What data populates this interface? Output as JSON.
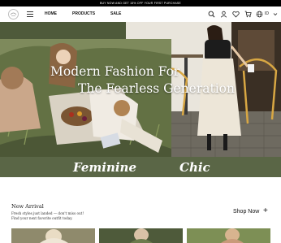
{
  "announcement": "BUY NOW AND GET 15% OFF YOUR FIRST PURCHASE",
  "nav": {
    "links": [
      "HOME",
      "PRODUCTS",
      "SALE"
    ],
    "icons": [
      "search-icon",
      "account-icon",
      "wishlist-icon",
      "cart-icon",
      "globe-icon"
    ],
    "language": "ID"
  },
  "hero": {
    "title_line1": "Modern Fashion For",
    "title_line2": "The Fearless Generation"
  },
  "band": {
    "word1": "Feminine",
    "word2": "Chic"
  },
  "new_arrival": {
    "title": "New Arrival",
    "subtitle_line1": "Fresh styles just landed — don't miss out!",
    "subtitle_line2": "Find your next favorite outfit today.",
    "shop_now": "Shop Now",
    "shop_plus": "+"
  },
  "colors": {
    "band": "#5a6646",
    "topbar": "#000000"
  }
}
